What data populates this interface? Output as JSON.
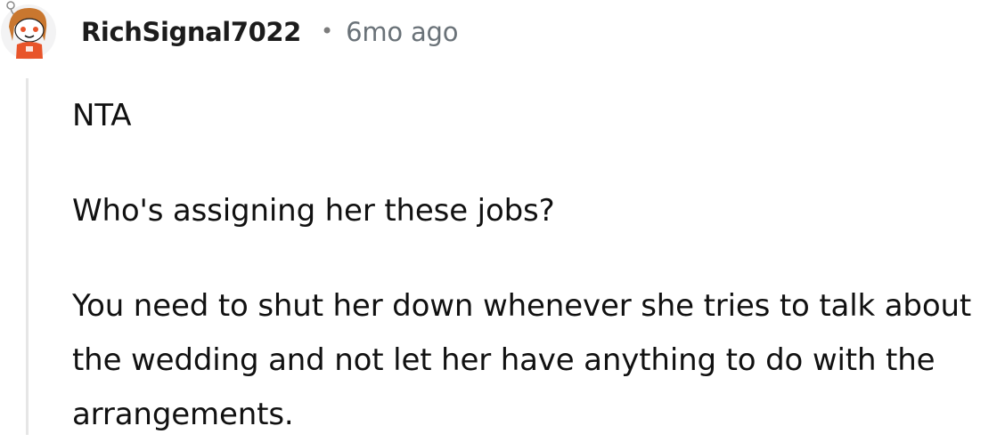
{
  "comment": {
    "author": {
      "username": "RichSignal7022",
      "avatar_icon": "snoo-avatar-icon"
    },
    "separator": "•",
    "timestamp": "6mo ago",
    "paragraphs": [
      "NTA",
      "Who's assigning her these jobs?",
      "You need to shut her down whenever she tries to talk about the wedding and not let her have anything to do with the arrangements."
    ]
  },
  "colors": {
    "username": "#1c1c1c",
    "timestamp": "#6a7278",
    "thread_line": "#e6e6e6",
    "avatar_hair": "#c9772f",
    "avatar_outfit": "#e8542a"
  }
}
